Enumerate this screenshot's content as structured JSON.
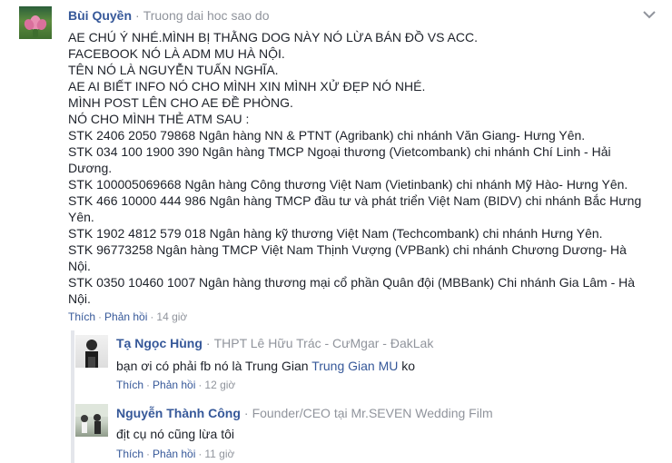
{
  "post": {
    "author": {
      "name": "Bùi Quyền",
      "subtitle": "Truong dai hoc sao do",
      "separator": "·"
    },
    "body_lines": [
      "AE CHÚ Ý NHÉ.MÌNH BỊ THẰNG DOG NÀY NÓ LỪA BÁN ĐỒ VS ACC.",
      "FACEBOOK NÓ LÀ ADM MU HÀ NỘI.",
      "TÊN NÓ LÀ NGUYỄN TUẤN NGHĨA.",
      "AE AI BIẾT INFO NÓ CHO MÌNH XIN MÌNH XỬ ĐẸP NÓ NHÉ.",
      "MÌNH POST LÊN CHO AE ĐỀ PHÒNG.",
      "NÓ CHO MÌNH THẺ ATM SAU :",
      "STK 2406 2050 79868 Ngân hàng NN & PTNT (Agribank) chi nhánh Văn Giang- Hưng Yên.",
      "STK 034 100 1900 390 Ngân hàng TMCP Ngoại thương (Vietcombank) chi nhánh Chí Linh - Hải",
      "Dương.",
      "STK 100005069668 Ngân hàng Công thương Việt Nam (Vietinbank) chi nhánh Mỹ Hào- Hưng Yên.",
      "STK 466 10000 444 986 Ngân hàng TMCP đầu tư và phát triển Việt Nam (BIDV) chi nhánh Bắc Hưng",
      "Yên.",
      "STK 1902 4812 579 018 Ngân hàng kỹ thương Việt Nam (Techcombank) chi nhánh Hưng Yên.",
      "STK 96773258 Ngân hàng TMCP Việt Nam Thịnh Vượng (VPBank) chi nhánh Chương Dương- Hà Nội.",
      "STK 0350 10460 1007 Ngân hàng thương mại cổ phần Quân đội (MBBank) Chi nhánh Gia Lâm - Hà",
      "Nội."
    ],
    "actions": {
      "like": "Thích",
      "reply": "Phản hồi",
      "dot": "·",
      "time": "14 giờ"
    }
  },
  "replies": [
    {
      "name": "Tạ Ngọc Hùng",
      "subtitle": "THPT Lê Hữu Trác - CưMgar - ĐakLak",
      "separator": "·",
      "text_before": "bạn ơi có phải fb nó là Trung Gian ",
      "mention": "Trung Gian MU",
      "text_after": " ko",
      "actions": {
        "like": "Thích",
        "reply": "Phản hồi",
        "dot": "·",
        "time": "12 giờ"
      }
    },
    {
      "name": "Nguyễn Thành Công",
      "subtitle": "Founder/CEO tại Mr.SEVEN Wedding Film",
      "separator": "·",
      "text": "địt cụ nó cũng lừa tôi",
      "actions": {
        "like": "Thích",
        "reply": "Phản hồi",
        "dot": "·",
        "time": "11 giờ"
      }
    }
  ],
  "colors": {
    "link": "#365899",
    "meta": "#90949c",
    "text": "#1d2129"
  },
  "icons": {
    "options": "chevron-down-icon"
  }
}
